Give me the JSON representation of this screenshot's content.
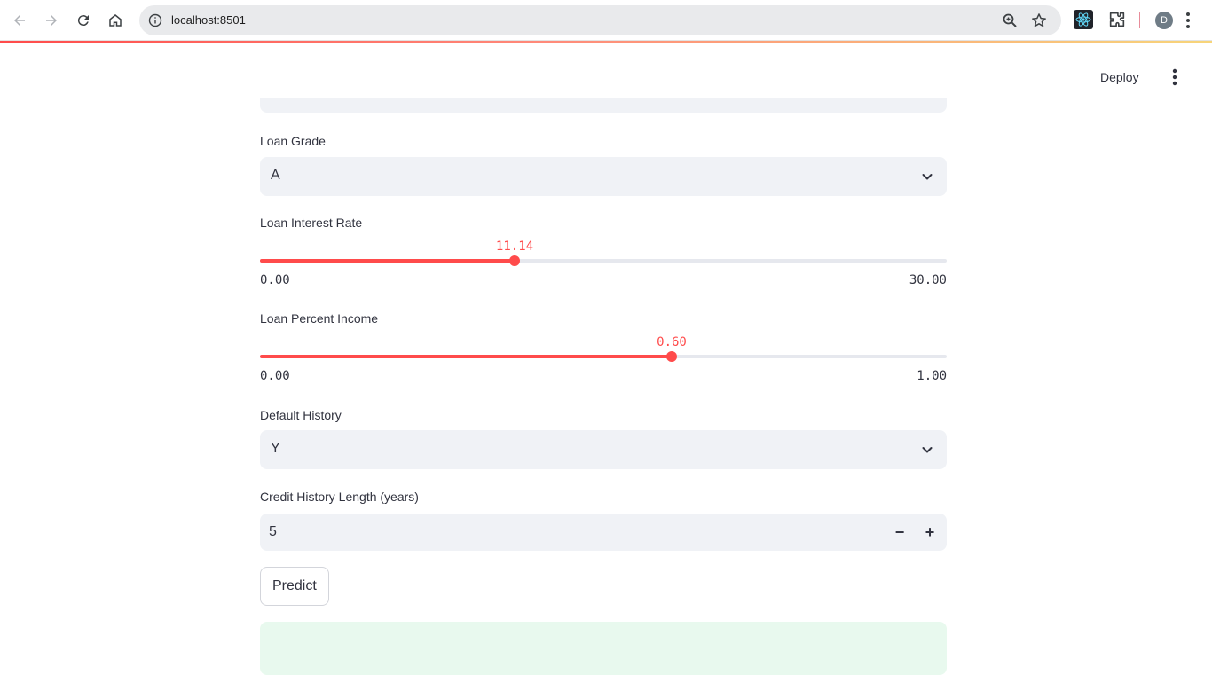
{
  "browser": {
    "url": "localhost:8501",
    "profile_initial": "D"
  },
  "header": {
    "deploy_label": "Deploy"
  },
  "form": {
    "loan_grade": {
      "label": "Loan Grade",
      "value": "A"
    },
    "interest_rate": {
      "label": "Loan Interest Rate",
      "value": "11.14",
      "min": "0.00",
      "max": "30.00",
      "fraction": 0.3713
    },
    "percent_income": {
      "label": "Loan Percent Income",
      "value": "0.60",
      "min": "0.00",
      "max": "1.00",
      "fraction": 0.6
    },
    "default_history": {
      "label": "Default History",
      "value": "Y"
    },
    "credit_history": {
      "label": "Credit History Length (years)",
      "value": "5",
      "minus": "−",
      "plus": "+"
    },
    "predict_label": "Predict"
  },
  "colors": {
    "accent": "#ff4b4b",
    "field_bg": "#f0f2f6",
    "success_bg": "#e8f9ee"
  }
}
